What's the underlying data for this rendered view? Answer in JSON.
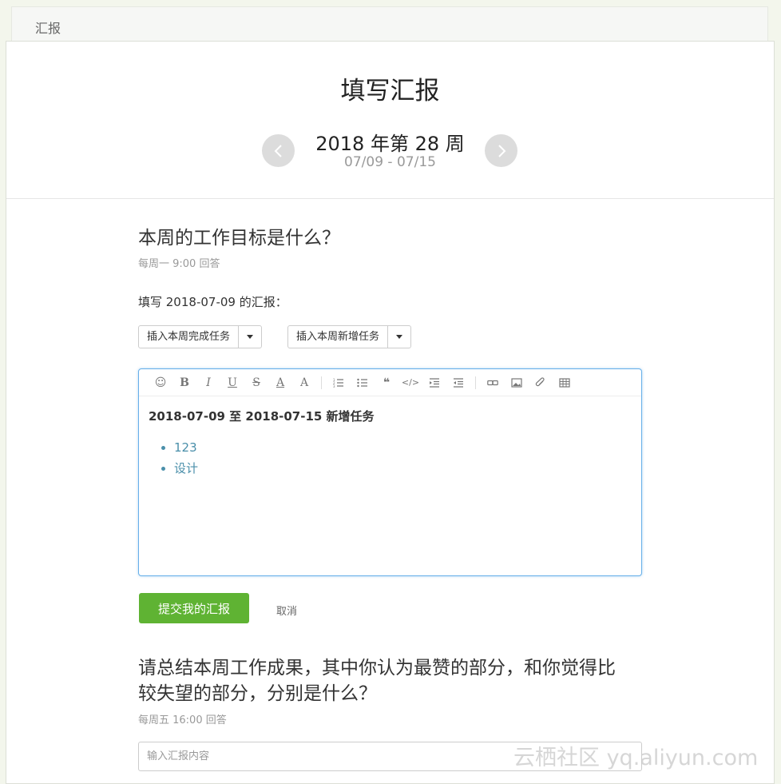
{
  "breadcrumb": "汇报",
  "header": {
    "title": "填写汇报",
    "week_title": "2018 年第 28 周",
    "week_range": "07/09 - 07/15"
  },
  "question1": {
    "title": "本周的工作目标是什么？",
    "schedule": "每周一 9:00 回答",
    "fill_label": "填写 2018-07-09 的汇报：",
    "insert_done_label": "插入本周完成任务",
    "insert_new_label": "插入本周新增任务",
    "editor": {
      "heading": "2018-07-09 至 2018-07-15 新增任务",
      "items": [
        "123",
        "设计"
      ]
    },
    "submit_label": "提交我的汇报",
    "cancel_label": "取消"
  },
  "question2": {
    "title_line1": "请总结本周工作成果，其中你认为最赞的部分，和你觉得比",
    "title_line2": "较失望的部分，分别是什么？",
    "schedule": "每周五 16:00 回答",
    "input_placeholder": "输入汇报内容"
  },
  "watermark": "云栖社区 yq.aliyun.com",
  "toolbar_icons": [
    "emoji-icon",
    "bold-icon",
    "italic-icon",
    "underline-icon",
    "strikethrough-icon",
    "font-color-icon",
    "font-size-icon",
    "ordered-list-icon",
    "unordered-list-icon",
    "blockquote-icon",
    "code-icon",
    "indent-icon",
    "outdent-icon",
    "link-icon",
    "image-icon",
    "attachment-icon",
    "table-icon"
  ],
  "colors": {
    "accent": "#5fb333",
    "link": "#4a8faa",
    "focus": "#66afe9"
  }
}
